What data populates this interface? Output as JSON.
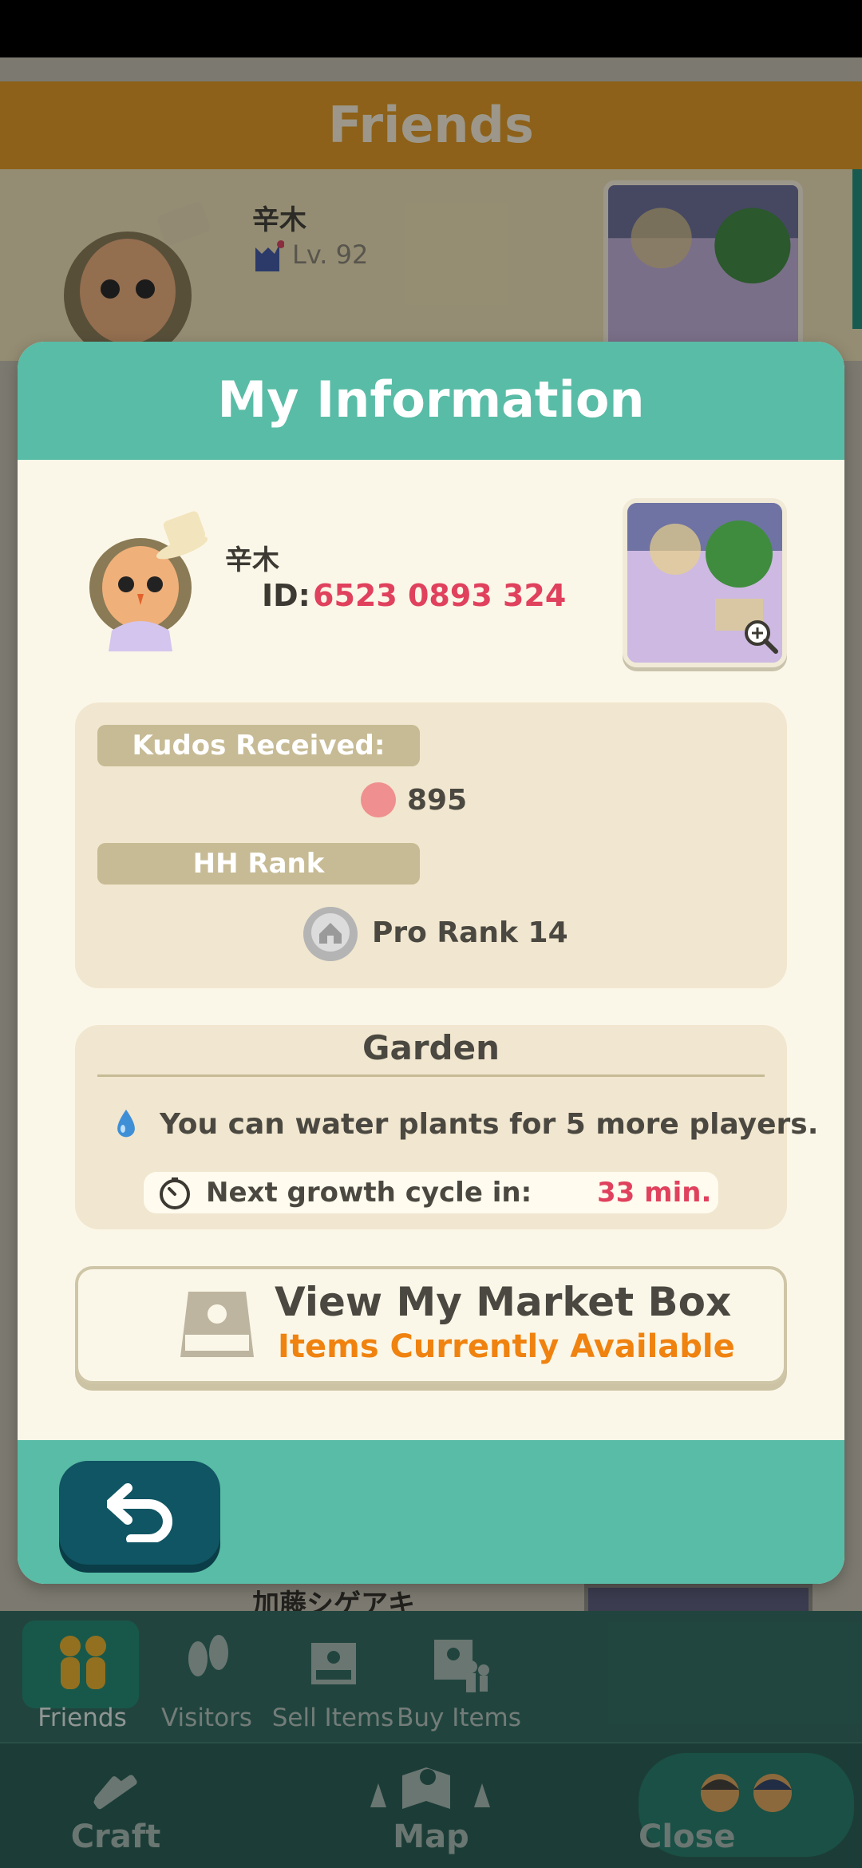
{
  "background": {
    "header_title": "Friends",
    "friend_1": {
      "name": "辛木",
      "level": "Lv. 92"
    },
    "friend_2": {
      "name": "加藤シゲアキ"
    }
  },
  "modal": {
    "title": "My Information",
    "player": {
      "name": "辛木",
      "id_label": "ID:",
      "id_value": "6523 0893 324"
    },
    "stats": {
      "kudos_label": "Kudos Received:",
      "kudos_value": "895",
      "rank_label": "HH Rank",
      "rank_value": "Pro Rank 14"
    },
    "garden": {
      "title": "Garden",
      "water_text": "You can water plants for 5 more players.",
      "growth_label": "Next growth cycle in:",
      "growth_value": "33 min."
    },
    "market": {
      "title": "View My Market Box",
      "subtitle": "Items Currently Available"
    }
  },
  "tabs": [
    {
      "label": "Friends",
      "icon": "friends-icon",
      "active": true
    },
    {
      "label": "Visitors",
      "icon": "footprints-icon",
      "active": false
    },
    {
      "label": "Sell Items",
      "icon": "market-box-icon",
      "active": false
    },
    {
      "label": "Buy Items",
      "icon": "buy-items-icon",
      "active": false
    }
  ],
  "nav": {
    "craft": "Craft",
    "map": "Map",
    "close": "Close"
  },
  "colors": {
    "teal": "#59bca6",
    "accent_red": "#e0415d",
    "accent_orange": "#f0820f",
    "dark_button": "#105563"
  }
}
